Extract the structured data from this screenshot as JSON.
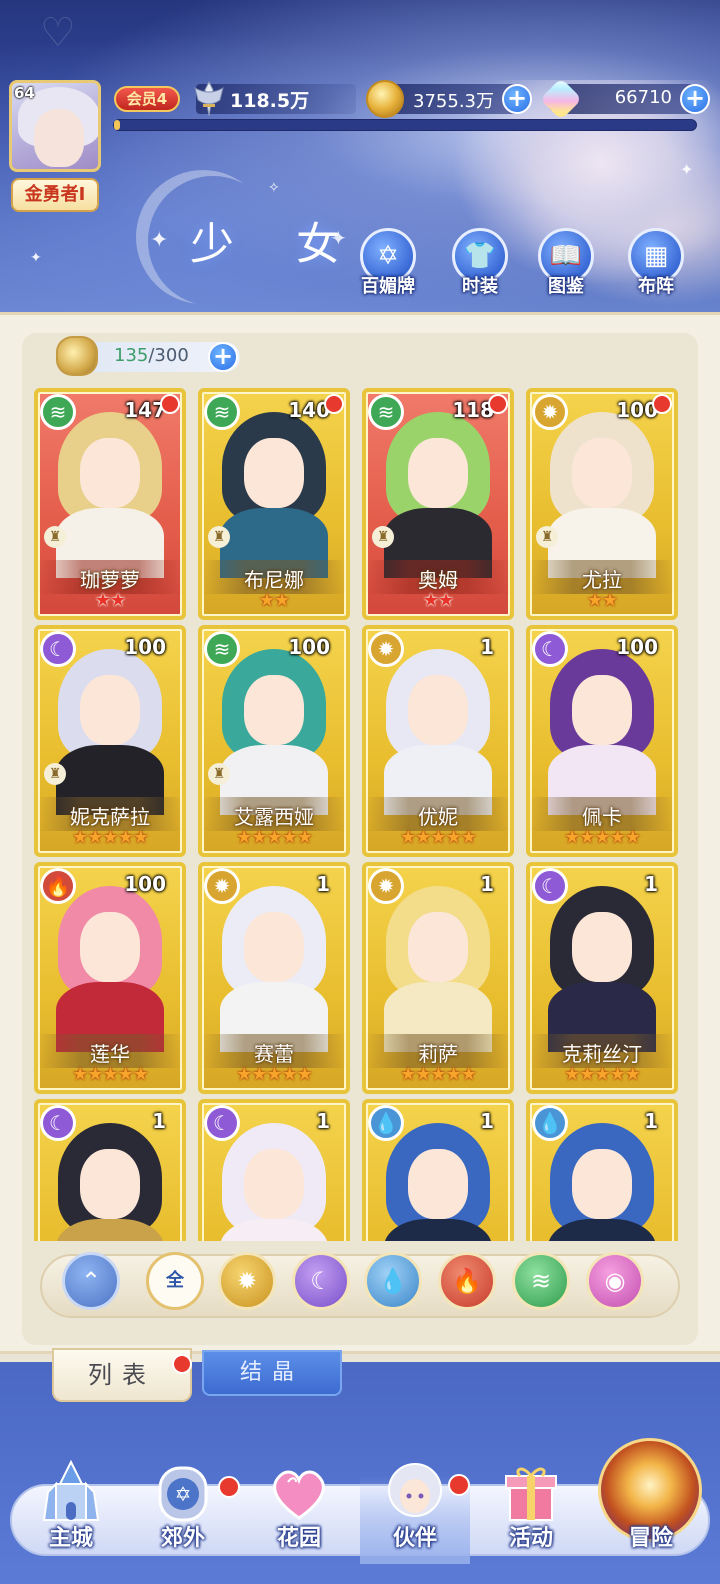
{
  "player": {
    "level": "64",
    "rank_title": "金勇者I",
    "vip_label": "会员4",
    "power": "118.5万",
    "exp_fraction": 0.01
  },
  "currencies": {
    "gold": "3755.3万",
    "gems": "66710"
  },
  "page_title": "少 女",
  "top_buttons": [
    {
      "label": "百媚牌",
      "icon": "card-deck-icon"
    },
    {
      "label": "时装",
      "icon": "outfit-icon"
    },
    {
      "label": "图鉴",
      "icon": "book-icon"
    },
    {
      "label": "布阵",
      "icon": "formation-grid-icon"
    }
  ],
  "capacity": {
    "current": "135",
    "max": "/300"
  },
  "characters": [
    {
      "name": "珈萝萝",
      "level": "147",
      "element": "wind",
      "rarity": "red",
      "stars": "★★",
      "dot": true,
      "rook": true
    },
    {
      "name": "布尼娜",
      "level": "140",
      "element": "wind",
      "rarity": "gold",
      "stars": "★★",
      "dot": true,
      "rook": true
    },
    {
      "name": "奥姆",
      "level": "118",
      "element": "wind",
      "rarity": "red",
      "stars": "★★",
      "dot": true,
      "rook": true
    },
    {
      "name": "尤拉",
      "level": "100",
      "element": "light",
      "rarity": "gold",
      "stars": "★★",
      "dot": true,
      "rook": true
    },
    {
      "name": "妮克萨拉",
      "level": "100",
      "element": "moon",
      "rarity": "gold",
      "stars": "★★★★★",
      "dot": false,
      "rook": true
    },
    {
      "name": "艾露西娅",
      "level": "100",
      "element": "wind",
      "rarity": "gold",
      "stars": "★★★★★",
      "dot": false,
      "rook": true
    },
    {
      "name": "优妮",
      "level": "1",
      "element": "light",
      "rarity": "gold",
      "stars": "★★★★★",
      "dot": false,
      "rook": false
    },
    {
      "name": "佩卡",
      "level": "100",
      "element": "moon",
      "rarity": "gold",
      "stars": "★★★★★",
      "dot": false,
      "rook": false
    },
    {
      "name": "莲华",
      "level": "100",
      "element": "fire",
      "rarity": "gold",
      "stars": "★★★★★",
      "dot": false,
      "rook": false
    },
    {
      "name": "赛蕾",
      "level": "1",
      "element": "light",
      "rarity": "gold",
      "stars": "★★★★★",
      "dot": false,
      "rook": false
    },
    {
      "name": "莉萨",
      "level": "1",
      "element": "light",
      "rarity": "gold",
      "stars": "★★★★★",
      "dot": false,
      "rook": false
    },
    {
      "name": "克莉丝汀",
      "level": "1",
      "element": "moon",
      "rarity": "gold",
      "stars": "★★★★★",
      "dot": false,
      "rook": false
    },
    {
      "name": "",
      "level": "1",
      "element": "moon",
      "rarity": "gold",
      "stars": "",
      "dot": false,
      "rook": false
    },
    {
      "name": "",
      "level": "1",
      "element": "moon",
      "rarity": "gold",
      "stars": "",
      "dot": false,
      "rook": false
    },
    {
      "name": "",
      "level": "1",
      "element": "water",
      "rarity": "gold",
      "stars": "",
      "dot": false,
      "rook": false
    },
    {
      "name": "",
      "level": "1",
      "element": "water",
      "rarity": "gold",
      "stars": "",
      "dot": false,
      "rook": false
    }
  ],
  "filters": {
    "all_label": "全",
    "items": [
      "collapse",
      "all",
      "light",
      "moon",
      "water",
      "fire",
      "wind",
      "special"
    ]
  },
  "tabs": [
    {
      "label": "列表",
      "active": true,
      "dot": true
    },
    {
      "label": "结晶",
      "active": false,
      "dot": false
    }
  ],
  "bottom_nav": [
    {
      "label": "主城",
      "icon": "castle-icon",
      "dot": false,
      "active": false
    },
    {
      "label": "郊外",
      "icon": "portal-icon",
      "dot": true,
      "active": false
    },
    {
      "label": "花园",
      "icon": "heart-garden-icon",
      "dot": false,
      "active": false
    },
    {
      "label": "伙伴",
      "icon": "companion-icon",
      "dot": true,
      "active": true
    },
    {
      "label": "活动",
      "icon": "gift-box-icon",
      "dot": false,
      "active": false
    },
    {
      "label": "冒险",
      "icon": "adventure-orb-icon",
      "dot": false,
      "active": false
    }
  ],
  "colors": {
    "element_wind": "#3ea857",
    "element_light": "#d9a531",
    "element_moon": "#8f5ad6",
    "element_fire": "#d14a3a",
    "element_water": "#4a95d6",
    "card_gold": "#e8c43a",
    "card_red": "#e45c4a"
  }
}
